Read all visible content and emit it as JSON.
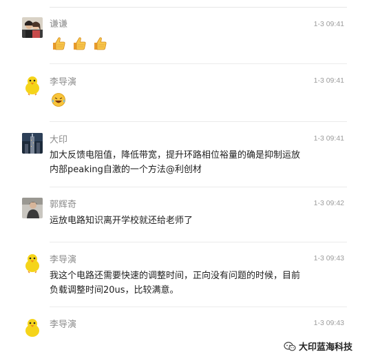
{
  "comments": [
    {
      "author": "谦谦",
      "time": "1-3 09:41",
      "avatar": "couple-photo-avatar",
      "content_type": "emoji",
      "emojis": [
        "thumbs-up-icon",
        "thumbs-up-icon",
        "thumbs-up-icon"
      ]
    },
    {
      "author": "李导演",
      "time": "1-3 09:41",
      "avatar": "yellow-chick-avatar",
      "content_type": "emoji",
      "emojis": [
        "laughing-tears-icon"
      ]
    },
    {
      "author": "大印",
      "time": "1-3 09:41",
      "avatar": "tower-photo-avatar",
      "content_type": "text",
      "text_lines": [
        "加大反馈电阻值，降低带宽，提升环路相位裕量的确是抑制运放",
        "内部peaking自激的一个方法@利创材"
      ]
    },
    {
      "author": "郭辉奇",
      "time": "1-3 09:42",
      "avatar": "person-photo-avatar",
      "content_type": "text",
      "text_lines": [
        "运放电路知识离开学校就还给老师了"
      ]
    },
    {
      "author": "李导演",
      "time": "1-3 09:43",
      "avatar": "yellow-chick-avatar",
      "content_type": "text",
      "text_lines": [
        "我这个电路还需要快速的调整时间，正向没有问题的时候，目前",
        "负载调整时间20us，比较满意。"
      ]
    },
    {
      "author": "李导演",
      "time": "1-3 09:43",
      "avatar": "yellow-chick-avatar",
      "content_type": "partial"
    }
  ],
  "watermark": {
    "text": "大印蓝海科技",
    "icon": "wechat-icon"
  }
}
